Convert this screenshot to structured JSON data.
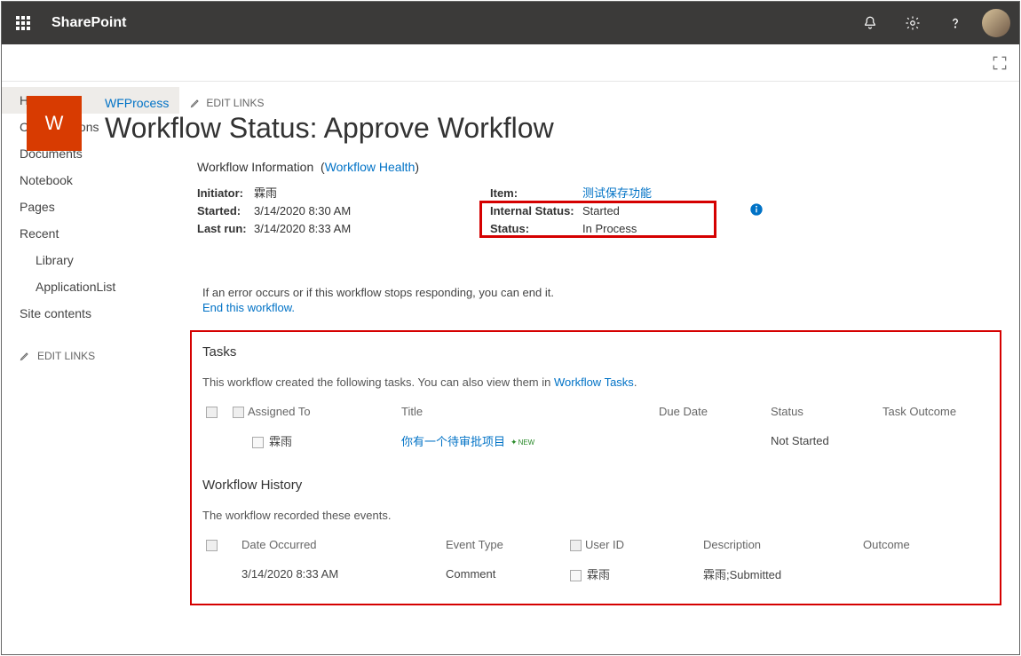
{
  "suitebar": {
    "brand": "SharePoint"
  },
  "site": {
    "logo_letter": "W",
    "name": "WFProcess",
    "edit_links": "EDIT LINKS",
    "page_title": "Workflow Status: Approve Workflow"
  },
  "leftnav": {
    "items": [
      {
        "label": "Home",
        "selected": true
      },
      {
        "label": "Conversations"
      },
      {
        "label": "Documents"
      },
      {
        "label": "Notebook"
      },
      {
        "label": "Pages"
      },
      {
        "label": "Recent"
      },
      {
        "label": "Library",
        "sub": true
      },
      {
        "label": "ApplicationList",
        "sub": true
      },
      {
        "label": "Site contents"
      }
    ],
    "edit_links": "EDIT LINKS"
  },
  "workflow_info": {
    "heading": "Workflow Information",
    "health_link_open": "(",
    "health_link": "Workflow Health",
    "health_link_close": ")",
    "left": {
      "initiator_k": "Initiator:",
      "initiator_v": "霖雨",
      "started_k": "Started:",
      "started_v": "3/14/2020 8:30 AM",
      "lastrun_k": "Last run:",
      "lastrun_v": "3/14/2020 8:33 AM"
    },
    "right": {
      "item_k": "Item:",
      "item_v": "测试保存功能",
      "internal_k": "Internal Status:",
      "internal_v": "Started",
      "status_k": "Status:",
      "status_v": "In Process"
    }
  },
  "error_box": {
    "line1": "If an error occurs or if this workflow stops responding, you can end it.",
    "end_link": "End this workflow."
  },
  "tasks": {
    "title": "Tasks",
    "subtext_pre": "This workflow created the following tasks. You can also view them in ",
    "subtext_link": "Workflow Tasks",
    "subtext_post": ".",
    "headers": {
      "assigned_to": "Assigned To",
      "title": "Title",
      "due_date": "Due Date",
      "status": "Status",
      "outcome": "Task Outcome"
    },
    "row": {
      "assigned_to": "霖雨",
      "title": "你有一个待审批项目",
      "new_badge": "NEW",
      "due_date": "",
      "status": "Not Started",
      "outcome": ""
    }
  },
  "history": {
    "title": "Workflow History",
    "subtext": "The workflow recorded these events.",
    "headers": {
      "date": "Date Occurred",
      "type": "Event Type",
      "user": "User ID",
      "desc": "Description",
      "outcome": "Outcome"
    },
    "row": {
      "date": "3/14/2020 8:33 AM",
      "type": "Comment",
      "user": "霖雨",
      "desc": "霖雨;Submitted",
      "outcome": ""
    }
  }
}
